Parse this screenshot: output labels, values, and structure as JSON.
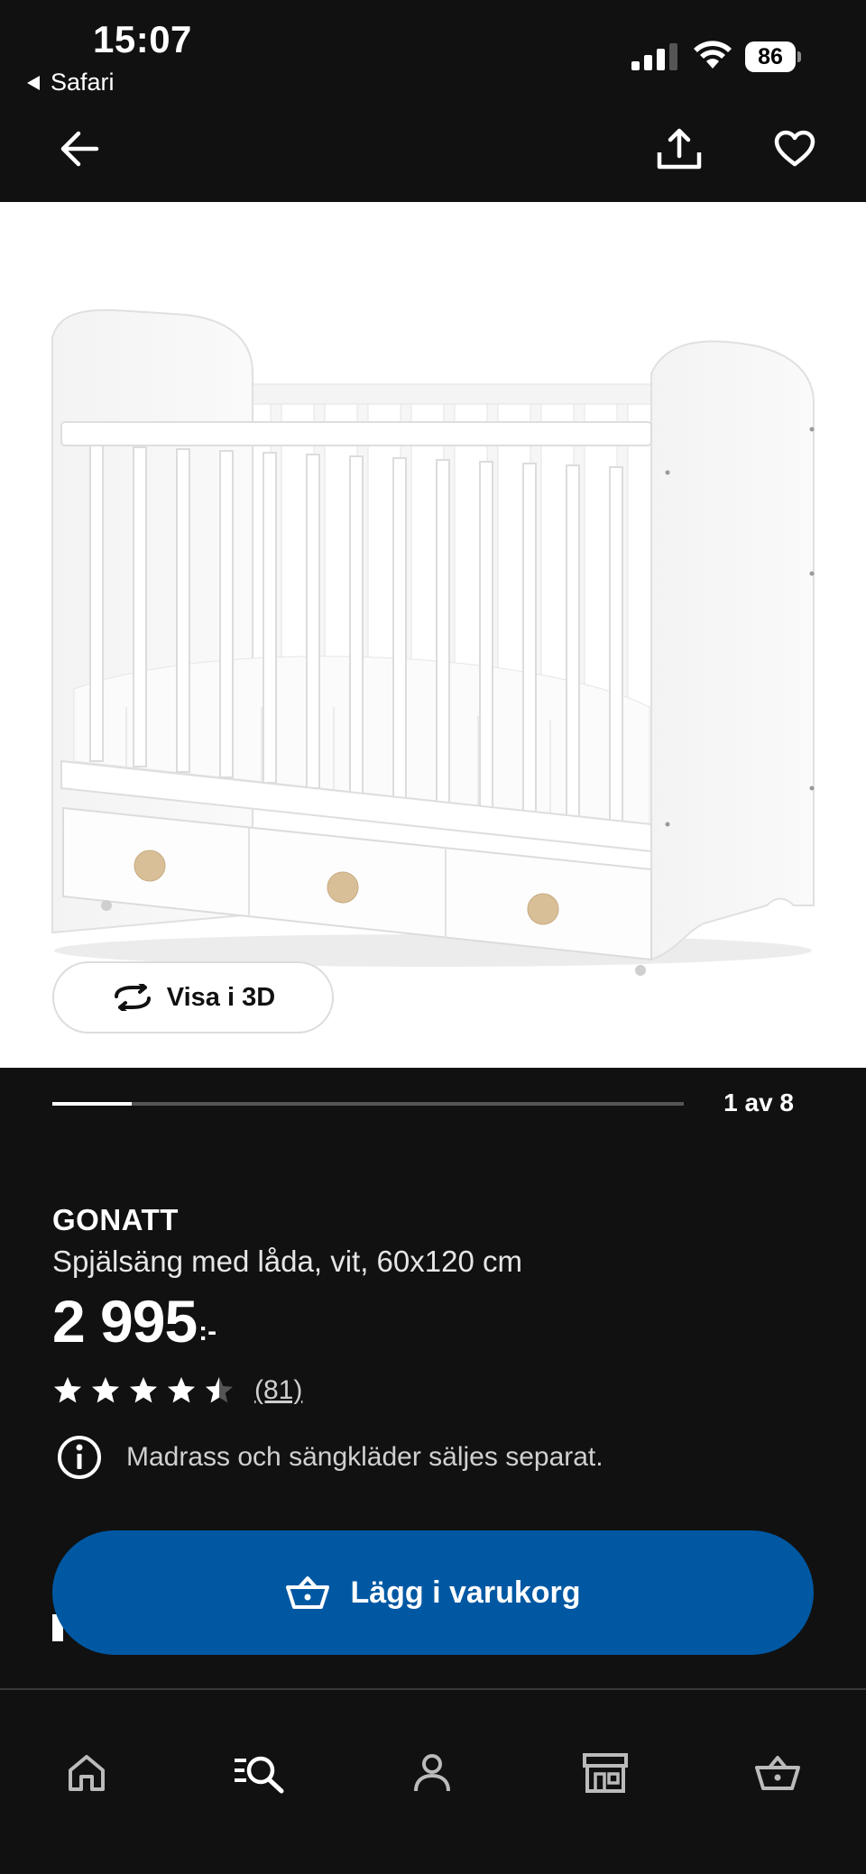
{
  "status_bar": {
    "time": "15:07",
    "back_app": "Safari",
    "battery": "86"
  },
  "header": {
    "back_icon": "arrow-left-icon",
    "share_icon": "share-icon",
    "favorite_icon": "heart-icon"
  },
  "gallery": {
    "view_3d_label": "Visa i 3D",
    "view_3d_icon": "rotate-icon",
    "counter": "1 av 8",
    "progress": 0.125
  },
  "product": {
    "name": "GONATT",
    "description": "Spjälsäng med låda, vit, 60x120 cm",
    "price": "2 995",
    "price_suffix": ":-",
    "rating": 4.5,
    "rating_max": 5,
    "review_count": "(81)",
    "notice": "Madrass och sängkläder säljes separat.",
    "notice_icon": "info-icon"
  },
  "cta": {
    "label": "Lägg i varukorg",
    "icon": "basket-icon",
    "color": "#0058a3"
  },
  "bottom_nav": {
    "items": [
      {
        "name": "home",
        "icon": "home-icon"
      },
      {
        "name": "search",
        "icon": "search-list-icon"
      },
      {
        "name": "profile",
        "icon": "person-icon"
      },
      {
        "name": "stores",
        "icon": "store-icon"
      },
      {
        "name": "cart",
        "icon": "basket-icon"
      }
    ]
  }
}
